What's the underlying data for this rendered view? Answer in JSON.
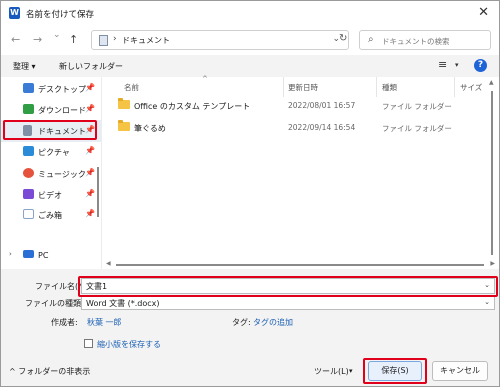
{
  "window": {
    "title": "名前を付けて保存",
    "app_icon_letter": "W",
    "close_glyph": "✕"
  },
  "nav": {
    "back": "←",
    "forward": "→",
    "history": "⌄",
    "up": "↑",
    "address_sep": "›",
    "address": "ドキュメント",
    "address_chevron": "⌄",
    "refresh": "↻",
    "search_placeholder": "ドキュメントの検索"
  },
  "toolbar": {
    "organize": "整理 ▾",
    "new_folder": "新しいフォルダー",
    "view_glyph": "≡",
    "view_chevron": "▾",
    "help": "?"
  },
  "sidebar": {
    "items": [
      {
        "label": "デスクトップ",
        "pin": "📌",
        "icon_color": "#3a7bd5"
      },
      {
        "label": "ダウンロード",
        "pin": "📌",
        "icon_color": "#2f9e44"
      },
      {
        "label": "ドキュメント",
        "pin": "📌",
        "icon_color": "#7f8fa6"
      },
      {
        "label": "ピクチャ",
        "pin": "📌",
        "icon_color": "#2a8cd9"
      },
      {
        "label": "ミュージック",
        "pin": "📌",
        "icon_color": "#e5533d"
      },
      {
        "label": "ビデオ",
        "pin": "📌",
        "icon_color": "#7b4bd6"
      },
      {
        "label": "ごみ箱",
        "pin": "📌",
        "icon_color": "#8aa4c8"
      },
      {
        "label": "PC",
        "pin": "",
        "icon_color": "#2b6fd6"
      }
    ]
  },
  "filelist": {
    "columns": {
      "name": "名前",
      "date": "更新日時",
      "type": "種類",
      "size": "サイズ"
    },
    "sort_indicator": "^",
    "rows": [
      {
        "name": "Office のカスタム テンプレート",
        "date": "2022/08/01 16:57",
        "type": "ファイル フォルダー"
      },
      {
        "name": "筆ぐるめ",
        "date": "2022/09/14 16:54",
        "type": "ファイル フォルダー"
      }
    ]
  },
  "form": {
    "filename_label": "ファイル名(N):",
    "filename_value": "文書1",
    "filetype_label": "ファイルの種類(T):",
    "filetype_value": "Word 文書 (*.docx)",
    "author_label": "作成者:",
    "author_value": "秋葉 一郎",
    "tags_label": "タグ:",
    "tags_value": "タグの追加",
    "thumbnail_label": "縮小版を保存する",
    "dropdown_chevron": "⌄"
  },
  "footer": {
    "hide_folders": "^ フォルダーの非表示",
    "tools": "ツール(L)",
    "tools_chevron": "▾",
    "save": "保存(S)",
    "cancel": "キャンセル"
  },
  "colors": {
    "highlight": "#e0001b",
    "link": "#1a5fb4",
    "folder": "#f6c444"
  }
}
